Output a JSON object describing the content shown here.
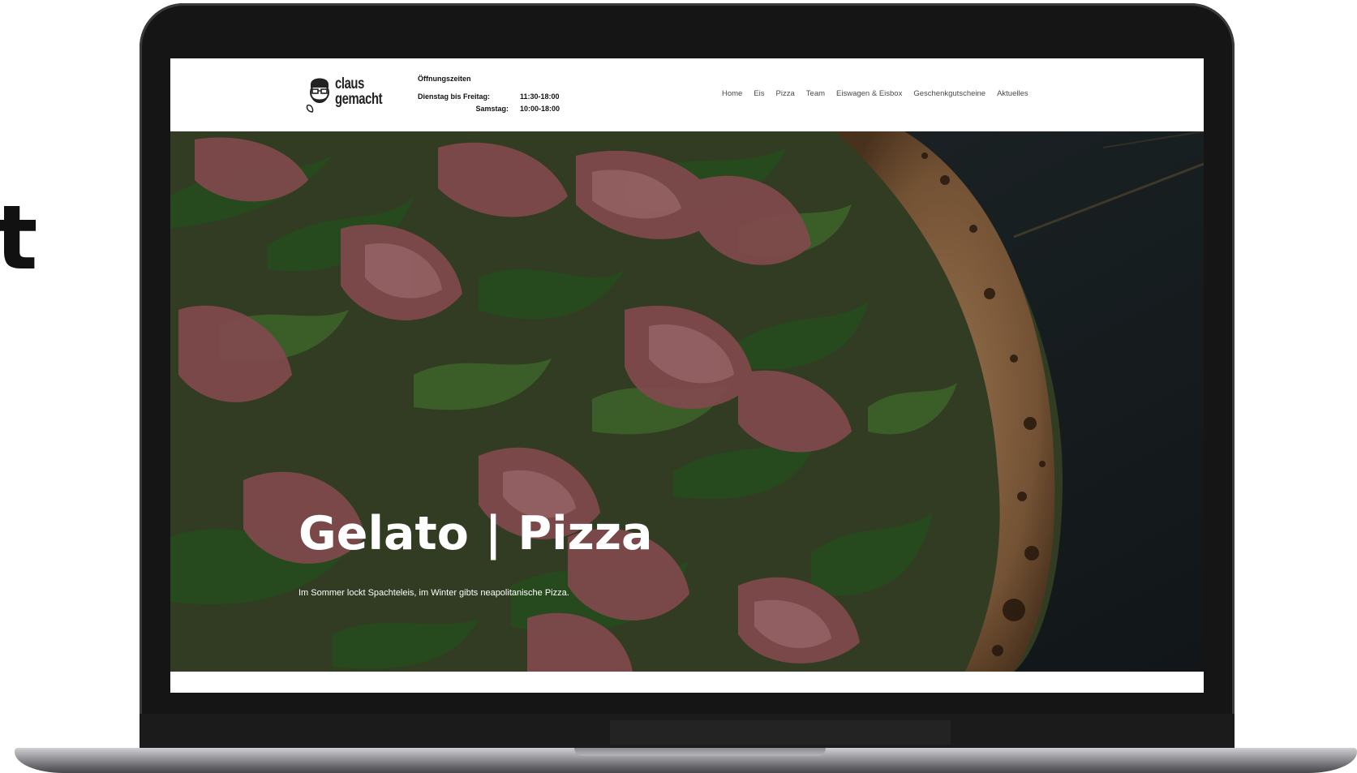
{
  "page_fragment": "t",
  "site": {
    "logo": {
      "icon": "bearded-face-icon",
      "line1": "claus",
      "line2": "gemacht"
    },
    "hours": {
      "title": "Öffnungszeiten",
      "rows": [
        {
          "day": "Dienstag bis Freitag:",
          "time": "11:30-18:00"
        },
        {
          "day": "Samstag:",
          "time": "10:00-18:00"
        }
      ]
    },
    "nav": [
      {
        "label": "Home"
      },
      {
        "label": "Eis"
      },
      {
        "label": "Pizza"
      },
      {
        "label": "Team"
      },
      {
        "label": "Eiswagen & Eisbox"
      },
      {
        "label": "Geschenkgutscheine"
      },
      {
        "label": "Aktuelles"
      }
    ],
    "hero": {
      "title": "Gelato | Pizza",
      "subtitle": "Im Sommer lockt Spachteleis, im Winter gibts neapolitanische Pizza.",
      "image": "prosciutto-rucola-pizza-photo"
    }
  },
  "colors": {
    "laptop_bezel": "#151515",
    "header_bg": "#ffffff",
    "hero_text": "#ffffff",
    "nav_text": "#4a4a4a"
  }
}
